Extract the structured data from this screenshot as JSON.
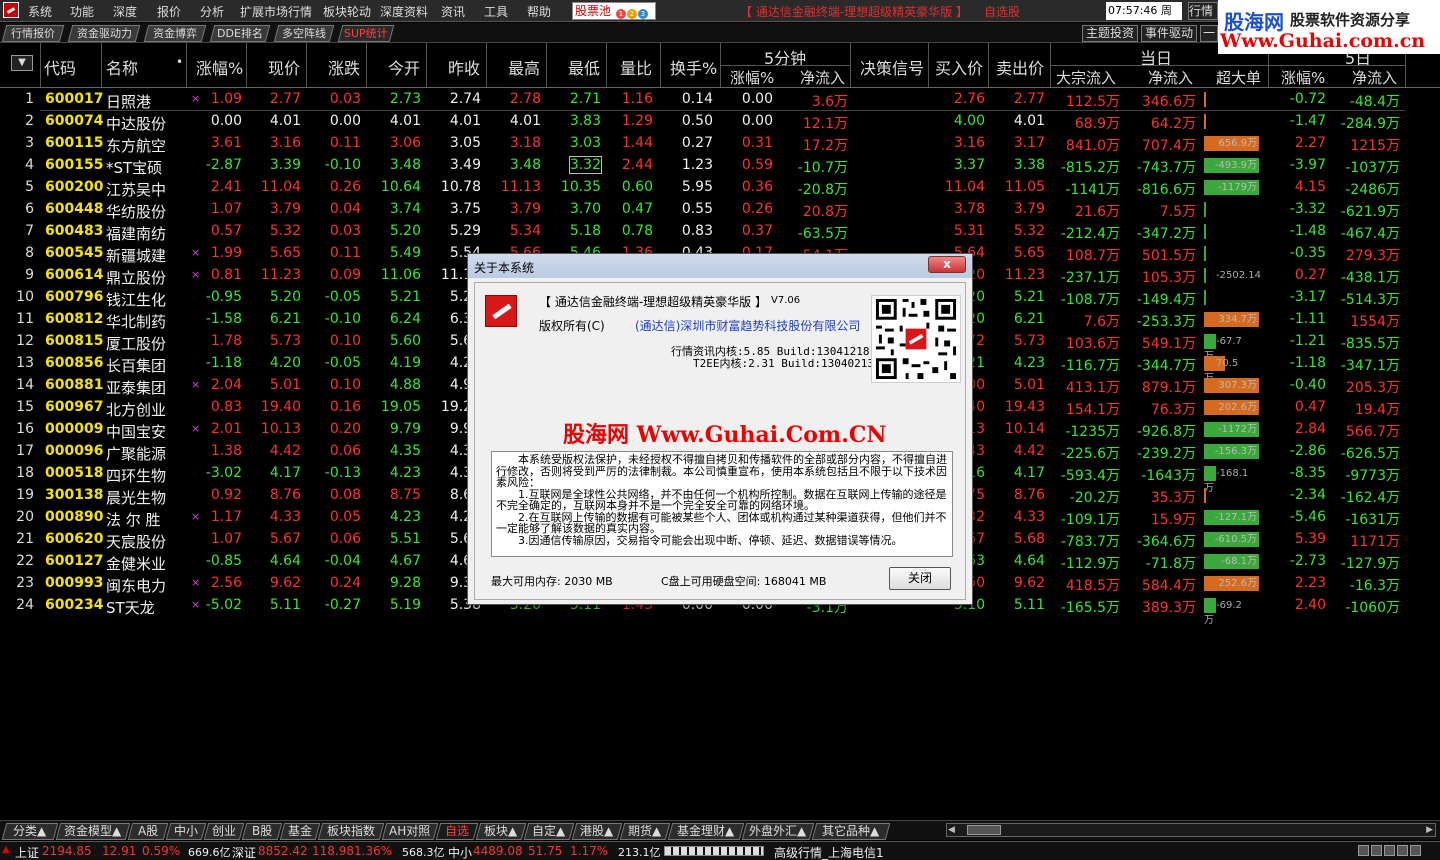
{
  "menu": {
    "items": [
      "系统",
      "功能",
      "深度",
      "报价",
      "分析",
      "扩展市场行情",
      "板块轮动",
      "深度资料",
      "资讯",
      "工具",
      "帮助"
    ],
    "pool_label": "股票池",
    "pool_badges": [
      "1",
      "2",
      "3",
      "4"
    ],
    "app_title": "【 通达信金融终端-理想超级精英豪华版 】",
    "custom_label": "自选股",
    "clock": "07:57:46 周三",
    "quote_button": "行情"
  },
  "watermark": {
    "brand": "股海网",
    "tagline": "股票软件资源分享",
    "url": "Www.Guhai.com.cn"
  },
  "tabs": {
    "left": [
      "行情报价",
      "资金驱动力",
      "资金博弈",
      "DDE排名",
      "多空阵线",
      "SUP统计"
    ],
    "right": [
      "主题投资",
      "事件驱动",
      "一"
    ]
  },
  "header": {
    "sort_icon": "▼",
    "code": "代码",
    "name": "名称",
    "dot": "•",
    "change_pct": "涨幅%",
    "price": "现价",
    "change": "涨跌",
    "open": "今开",
    "prev_close": "昨收",
    "high": "最高",
    "low": "最低",
    "vol_ratio": "量比",
    "turnover": "换手%",
    "five_min": "5分钟",
    "five_min_change": "涨幅%",
    "five_min_inflow": "净流入",
    "signal": "决策信号",
    "bid": "买入价",
    "ask": "卖出价",
    "today": "当日",
    "block_inflow": "大宗流入",
    "net_inflow": "净流入",
    "super_large": "超大单",
    "next_group": "5日",
    "next_change": "涨幅%",
    "next_inflow": "净流入"
  },
  "rows": [
    {
      "idx": "1",
      "code": "600017",
      "name": "日照港",
      "mark": "×",
      "chg": "1.09",
      "price": "2.77",
      "diff": "0.03",
      "open": "2.73",
      "prev": "2.74",
      "high": "2.78",
      "low": "2.71",
      "vr": "1.16",
      "turn": "0.14",
      "m5": "0.00",
      "m5in": "3.6万",
      "bid": "2.76",
      "ask": "2.77",
      "block": "112.5万",
      "net": "346.6万",
      "sup": "",
      "sup_dir": "r",
      "sup_frac": 0.01,
      "c5": "-0.72",
      "in5": "-48.4万"
    },
    {
      "idx": "2",
      "code": "600074",
      "name": "中达股份",
      "mark": "",
      "chg": "0.00",
      "price": "4.01",
      "diff": "0.00",
      "open": "4.01",
      "prev": "4.01",
      "high": "4.01",
      "low": "3.83",
      "vr": "1.29",
      "turn": "0.50",
      "m5": "0.00",
      "m5in": "12.1万",
      "bid": "4.00",
      "ask": "4.01",
      "block": "68.9万",
      "net": "64.2万",
      "sup": "",
      "sup_dir": "r",
      "sup_frac": 0.01,
      "c5": "-1.47",
      "in5": "-284.9万"
    },
    {
      "idx": "3",
      "code": "600115",
      "name": "东方航空",
      "mark": "",
      "chg": "3.61",
      "price": "3.16",
      "diff": "0.11",
      "open": "3.06",
      "prev": "3.05",
      "high": "3.18",
      "low": "3.03",
      "vr": "1.44",
      "turn": "0.27",
      "m5": "0.31",
      "m5in": "17.2万",
      "bid": "3.16",
      "ask": "3.17",
      "block": "841.0万",
      "net": "707.4万",
      "sup": "656.9万",
      "sup_dir": "r",
      "sup_frac": 0.92,
      "c5": "2.27",
      "in5": "1215万"
    },
    {
      "idx": "4",
      "code": "600155",
      "name": "*ST宝硕",
      "mark": "",
      "chg": "-2.87",
      "price": "3.39",
      "diff": "-0.10",
      "open": "3.48",
      "prev": "3.49",
      "high": "3.48",
      "low": "3.32",
      "vr": "2.44",
      "turn": "1.23",
      "m5": "0.59",
      "m5in": "-10.7万",
      "bid": "3.37",
      "ask": "3.38",
      "block": "-815.2万",
      "net": "-743.7万",
      "sup": "-493.9万",
      "sup_dir": "g",
      "sup_frac": 0.92,
      "c5": "-3.97",
      "in5": "-1037万"
    },
    {
      "idx": "5",
      "code": "600200",
      "name": "江苏吴中",
      "mark": "",
      "chg": "2.41",
      "price": "11.04",
      "diff": "0.26",
      "open": "10.64",
      "prev": "10.78",
      "high": "11.13",
      "low": "10.35",
      "vr": "0.60",
      "turn": "5.95",
      "m5": "0.36",
      "m5in": "-20.8万",
      "bid": "11.04",
      "ask": "11.05",
      "block": "-1141万",
      "net": "-816.6万",
      "sup": "-1179万",
      "sup_dir": "g",
      "sup_frac": 0.92,
      "c5": "4.15",
      "in5": "-2486万"
    },
    {
      "idx": "6",
      "code": "600448",
      "name": "华纺股份",
      "mark": "",
      "chg": "1.07",
      "price": "3.79",
      "diff": "0.04",
      "open": "3.74",
      "prev": "3.75",
      "high": "3.79",
      "low": "3.70",
      "vr": "0.47",
      "turn": "0.55",
      "m5": "0.26",
      "m5in": "20.8万",
      "bid": "3.78",
      "ask": "3.79",
      "block": "21.6万",
      "net": "7.5万",
      "sup": "",
      "sup_dir": "r",
      "sup_frac": 0,
      "c5": "-3.32",
      "in5": "-621.9万"
    },
    {
      "idx": "7",
      "code": "600483",
      "name": "福建南纺",
      "mark": "",
      "chg": "0.57",
      "price": "5.32",
      "diff": "0.03",
      "open": "5.20",
      "prev": "5.29",
      "high": "5.34",
      "low": "5.18",
      "vr": "0.78",
      "turn": "0.83",
      "m5": "0.37",
      "m5in": "-63.5万",
      "bid": "5.31",
      "ask": "5.32",
      "block": "-212.4万",
      "net": "-347.2万",
      "sup": "",
      "sup_dir": "g",
      "sup_frac": 0,
      "c5": "-1.48",
      "in5": "-467.4万"
    },
    {
      "idx": "8",
      "code": "600545",
      "name": "新疆城建",
      "mark": "×",
      "chg": "1.99",
      "price": "5.65",
      "diff": "0.11",
      "open": "5.49",
      "prev": "5.54",
      "high": "5.66",
      "low": "5.46",
      "vr": "1.36",
      "turn": "0.43",
      "m5": "0.17",
      "m5in": "54.1万",
      "bid": "5.64",
      "ask": "5.65",
      "block": "108.7万",
      "net": "501.5万",
      "sup": "",
      "sup_dir": "r",
      "sup_frac": 0,
      "c5": "-0.35",
      "in5": "279.3万"
    },
    {
      "idx": "9",
      "code": "600614",
      "name": "鼎立股份",
      "mark": "×",
      "chg": "0.81",
      "price": "11.23",
      "diff": "0.09",
      "open": "11.06",
      "prev": "11.14",
      "high": "",
      "low": "",
      "vr": "",
      "turn": "",
      "m5": "",
      "m5in": "",
      "bid": "11.20",
      "ask": "11.23",
      "block": "-237.1万",
      "net": "105.3万",
      "sup": "-2502.14",
      "sup_dir": "g",
      "sup_frac": 0.03,
      "c5": "0.27",
      "in5": "-438.1万"
    },
    {
      "idx": "10",
      "code": "600796",
      "name": "钱江生化",
      "mark": "",
      "chg": "-0.95",
      "price": "5.20",
      "diff": "-0.05",
      "open": "5.21",
      "prev": "5.25",
      "high": "",
      "low": "",
      "vr": "",
      "turn": "",
      "m5": "",
      "m5in": "",
      "bid": "5.20",
      "ask": "5.21",
      "block": "-108.7万",
      "net": "-149.4万",
      "sup": "",
      "sup_dir": "g",
      "sup_frac": 0,
      "c5": "-3.17",
      "in5": "-514.3万"
    },
    {
      "idx": "11",
      "code": "600812",
      "name": "华北制药",
      "mark": "",
      "chg": "-1.58",
      "price": "6.21",
      "diff": "-0.10",
      "open": "6.24",
      "prev": "6.31",
      "high": "",
      "low": "",
      "vr": "",
      "turn": "",
      "m5": "",
      "m5in": "",
      "bid": "6.20",
      "ask": "6.21",
      "block": "7.6万",
      "net": "-253.3万",
      "sup": "334.7万",
      "sup_dir": "r",
      "sup_frac": 0.92,
      "c5": "-1.11",
      "in5": "1554万"
    },
    {
      "idx": "12",
      "code": "600815",
      "name": "厦工股份",
      "mark": "",
      "chg": "1.78",
      "price": "5.73",
      "diff": "0.10",
      "open": "5.60",
      "prev": "5.63",
      "high": "",
      "low": "",
      "vr": "",
      "turn": "",
      "m5": "",
      "m5in": "",
      "bid": "5.72",
      "ask": "5.73",
      "block": "103.6万",
      "net": "549.1万",
      "sup": "-67.7万",
      "sup_dir": "g",
      "sup_frac": 0.2,
      "c5": "-1.21",
      "in5": "-835.5万"
    },
    {
      "idx": "13",
      "code": "600856",
      "name": "长百集团",
      "mark": "",
      "chg": "-1.18",
      "price": "4.20",
      "diff": "-0.05",
      "open": "4.19",
      "prev": "4.25",
      "high": "",
      "low": "",
      "vr": "",
      "turn": "",
      "m5": "",
      "m5in": "",
      "bid": "4.21",
      "ask": "4.23",
      "block": "-116.7万",
      "net": "-344.7万",
      "sup": "70.5万",
      "sup_dir": "r",
      "sup_frac": 0.35,
      "c5": "-1.18",
      "in5": "-347.1万"
    },
    {
      "idx": "14",
      "code": "600881",
      "name": "亚泰集团",
      "mark": "×",
      "chg": "2.04",
      "price": "5.01",
      "diff": "0.10",
      "open": "4.88",
      "prev": "4.91",
      "high": "",
      "low": "",
      "vr": "",
      "turn": "",
      "m5": "",
      "m5in": "",
      "bid": "5.00",
      "ask": "5.01",
      "block": "413.1万",
      "net": "879.1万",
      "sup": "307.3万",
      "sup_dir": "r",
      "sup_frac": 0.92,
      "c5": "-0.40",
      "in5": "205.3万"
    },
    {
      "idx": "15",
      "code": "600967",
      "name": "北方创业",
      "mark": "",
      "chg": "0.83",
      "price": "19.40",
      "diff": "0.16",
      "open": "19.05",
      "prev": "19.24",
      "high": "",
      "low": "",
      "vr": "",
      "turn": "",
      "m5": "",
      "m5in": "",
      "bid": "19.40",
      "ask": "19.43",
      "block": "154.1万",
      "net": "76.3万",
      "sup": "202.6万",
      "sup_dir": "r",
      "sup_frac": 0.92,
      "c5": "0.47",
      "in5": "19.4万"
    },
    {
      "idx": "16",
      "code": "000009",
      "name": "中国宝安",
      "mark": "×",
      "chg": "2.01",
      "price": "10.13",
      "diff": "0.20",
      "open": "9.79",
      "prev": "9.93",
      "high": "",
      "low": "",
      "vr": "",
      "turn": "",
      "m5": "",
      "m5in": "",
      "bid": "10.13",
      "ask": "10.14",
      "block": "-1235万",
      "net": "-926.8万",
      "sup": "-1172万",
      "sup_dir": "g",
      "sup_frac": 0.92,
      "c5": "2.84",
      "in5": "566.7万"
    },
    {
      "idx": "17",
      "code": "000096",
      "name": "广聚能源",
      "mark": "",
      "chg": "1.38",
      "price": "4.42",
      "diff": "0.06",
      "open": "4.35",
      "prev": "4.36",
      "high": "",
      "low": "",
      "vr": "",
      "turn": "",
      "m5": "",
      "m5in": "",
      "bid": "4.43",
      "ask": "4.42",
      "block": "-225.6万",
      "net": "-239.2万",
      "sup": "-156.3万",
      "sup_dir": "g",
      "sup_frac": 0.92,
      "c5": "-2.86",
      "in5": "-626.5万"
    },
    {
      "idx": "18",
      "code": "000518",
      "name": "四环生物",
      "mark": "",
      "chg": "-3.02",
      "price": "4.17",
      "diff": "-0.13",
      "open": "4.23",
      "prev": "4.30",
      "high": "",
      "low": "",
      "vr": "",
      "turn": "",
      "m5": "",
      "m5in": "",
      "bid": "4.16",
      "ask": "4.17",
      "block": "-593.4万",
      "net": "-1643万",
      "sup": "-168.1万",
      "sup_dir": "g",
      "sup_frac": 0.2,
      "c5": "-8.35",
      "in5": "-9773万"
    },
    {
      "idx": "19",
      "code": "300138",
      "name": "晨光生物",
      "mark": "",
      "chg": "0.92",
      "price": "8.76",
      "diff": "0.08",
      "open": "8.75",
      "prev": "8.68",
      "high": "",
      "low": "",
      "vr": "",
      "turn": "",
      "m5": "",
      "m5in": "",
      "bid": "8.75",
      "ask": "8.76",
      "block": "-20.2万",
      "net": "35.3万",
      "sup": "",
      "sup_dir": "r",
      "sup_frac": 0.01,
      "c5": "-2.34",
      "in5": "-162.4万"
    },
    {
      "idx": "20",
      "code": "000890",
      "name": "法 尔 胜",
      "mark": "×",
      "chg": "1.17",
      "price": "4.33",
      "diff": "0.05",
      "open": "4.23",
      "prev": "4.28",
      "high": "",
      "low": "",
      "vr": "",
      "turn": "",
      "m5": "",
      "m5in": "",
      "bid": "4.32",
      "ask": "4.33",
      "block": "-109.1万",
      "net": "15.9万",
      "sup": "-127.1万",
      "sup_dir": "g",
      "sup_frac": 0.92,
      "c5": "-5.46",
      "in5": "-1631万"
    },
    {
      "idx": "21",
      "code": "600620",
      "name": "天宸股份",
      "mark": "",
      "chg": "1.07",
      "price": "5.67",
      "diff": "0.06",
      "open": "5.51",
      "prev": "5.61",
      "high": "",
      "low": "",
      "vr": "",
      "turn": "",
      "m5": "",
      "m5in": "",
      "bid": "5.67",
      "ask": "5.68",
      "block": "-783.7万",
      "net": "-364.6万",
      "sup": "-610.5万",
      "sup_dir": "g",
      "sup_frac": 0.92,
      "c5": "5.39",
      "in5": "1171万"
    },
    {
      "idx": "22",
      "code": "600127",
      "name": "金健米业",
      "mark": "",
      "chg": "-0.85",
      "price": "4.64",
      "diff": "-0.04",
      "open": "4.67",
      "prev": "4.68",
      "high": "",
      "low": "",
      "vr": "",
      "turn": "",
      "m5": "",
      "m5in": "",
      "bid": "4.63",
      "ask": "4.64",
      "block": "-112.9万",
      "net": "-71.8万",
      "sup": "-68.1万",
      "sup_dir": "g",
      "sup_frac": 0.92,
      "c5": "-2.73",
      "in5": "-127.9万"
    },
    {
      "idx": "23",
      "code": "000993",
      "name": "闽东电力",
      "mark": "×",
      "chg": "2.56",
      "price": "9.62",
      "diff": "0.24",
      "open": "9.28",
      "prev": "9.38",
      "high": "",
      "low": "",
      "vr": "",
      "turn": "",
      "m5": "",
      "m5in": "",
      "bid": "9.60",
      "ask": "9.62",
      "block": "418.5万",
      "net": "584.4万",
      "sup": "252.6万",
      "sup_dir": "r",
      "sup_frac": 0.92,
      "c5": "2.23",
      "in5": "-16.3万"
    },
    {
      "idx": "24",
      "code": "600234",
      "name": "ST天龙",
      "mark": "×",
      "chg": "-5.02",
      "price": "5.11",
      "diff": "-0.27",
      "open": "5.19",
      "prev": "5.38",
      "high": "5.20",
      "low": "5.11",
      "vr": "1.43",
      "turn": "0.00",
      "m5": "0.00",
      "m5in": "-3.1万",
      "bid": "5.10",
      "ask": "5.11",
      "block": "-165.5万",
      "net": "389.3万",
      "sup": "-69.2万",
      "sup_dir": "g",
      "sup_frac": 0.2,
      "c5": "2.40",
      "in5": "-1060万"
    }
  ],
  "dialog": {
    "title": "关于本系统",
    "close_x": "x",
    "app_name": "【 通达信金融终端-理想超级精英豪华版 】",
    "version": "V7.06",
    "copyright_label": "版权所有(C)",
    "copyright": "(通达信)深圳市财富趋势科技股份有限公司",
    "core1": "行情资讯内核:5.85 Build:13041218",
    "core2": "T2EE内核:2.31 Build:13040213",
    "watermark": "股海网 Www.Guhai.Com.CN",
    "text": [
      "本系统受版权法保护，未经授权不得擅自拷贝和传播软件的全部或部分内容，不得擅自进行修改，否则将受到严厉的法律制裁。本公司慎重宣布，使用本系统包括且不限于以下技术因素风险：",
      "1.互联网是全球性公共网络，并不由任何一个机构所控制。数据在互联网上传输的途径是不完全确定的，互联网本身并不是一个完全安全可靠的网络环境。",
      "2.在互联网上传输的数据有可能被某些个人、团体或机构通过某种渠道获得，但他们并不一定能够了解该数据的真实内容。",
      "3.因通信传输原因，交易指令可能会出现中断、停顿、延迟、数据错误等情况。"
    ],
    "memory": "最大可用内存: 2030 MB",
    "disk": "C盘上可用硬盘空间: 168041 MB",
    "ok": "关闭"
  },
  "bottom_tabs": [
    "分类▲",
    "资金模型▲",
    "A股",
    "中小",
    "创业",
    "B股",
    "基金",
    "板块指数",
    "AH对照",
    "自选",
    "板块▲",
    "自定▲",
    "港股▲",
    "期货▲",
    "基金理财▲",
    "外盘外汇▲",
    "其它品种▲"
  ],
  "status": {
    "sh_label": "上证",
    "sh_index": "2194.85",
    "sh_diff": "12.91",
    "sh_pct": "0.59%",
    "sh_amt": "669.6亿",
    "sz_label": "深证",
    "sz_index": "8852.42",
    "sz_diff": "118.98",
    "sz_pct": "1.36%",
    "sz_amt": "568.3亿",
    "zx_label": "中小",
    "zx_index": "4489.08",
    "zx_diff": "51.75",
    "zx_pct": "1.17%",
    "zx_amt": "213.1亿",
    "feed": "高级行情_上海电信1"
  },
  "colors": {
    "up": "#ff3030",
    "down": "#33e833",
    "flat": "#f0f0f0",
    "code": "#f5e400"
  }
}
